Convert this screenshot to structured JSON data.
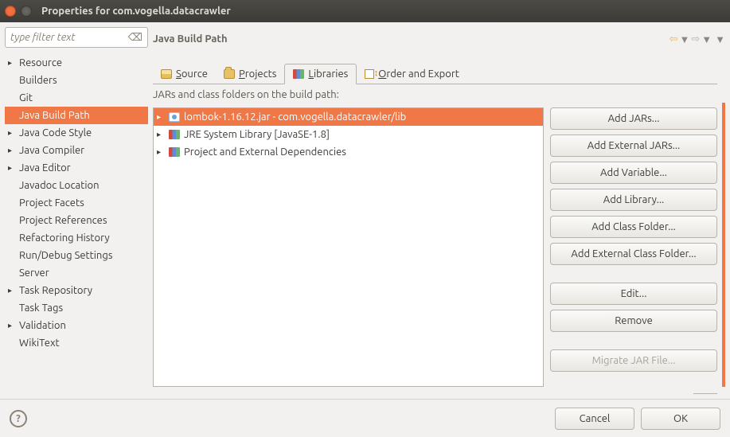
{
  "window": {
    "title": "Properties for com.vogella.datacrawler"
  },
  "filter": {
    "placeholder": "type filter text"
  },
  "navTree": [
    {
      "label": "Resource",
      "expandable": true
    },
    {
      "label": "Builders",
      "expandable": false
    },
    {
      "label": "Git",
      "expandable": false
    },
    {
      "label": "Java Build Path",
      "expandable": false,
      "selected": true
    },
    {
      "label": "Java Code Style",
      "expandable": true
    },
    {
      "label": "Java Compiler",
      "expandable": true
    },
    {
      "label": "Java Editor",
      "expandable": true
    },
    {
      "label": "Javadoc Location",
      "expandable": false
    },
    {
      "label": "Project Facets",
      "expandable": false
    },
    {
      "label": "Project References",
      "expandable": false
    },
    {
      "label": "Refactoring History",
      "expandable": false
    },
    {
      "label": "Run/Debug Settings",
      "expandable": false
    },
    {
      "label": "Server",
      "expandable": false
    },
    {
      "label": "Task Repository",
      "expandable": true
    },
    {
      "label": "Task Tags",
      "expandable": false
    },
    {
      "label": "Validation",
      "expandable": true
    },
    {
      "label": "WikiText",
      "expandable": false
    }
  ],
  "page": {
    "title": "Java Build Path",
    "tabs": {
      "source": "Source",
      "projects": "Projects",
      "libraries": "Libraries",
      "order": "Order and Export"
    },
    "desc": "JARs and class folders on the build path:",
    "libs": [
      {
        "label": "lombok-1.16.12.jar - com.vogella.datacrawler/lib",
        "icon": "jar",
        "selected": true
      },
      {
        "label": "JRE System Library [JavaSE-1.8]",
        "icon": "lib"
      },
      {
        "label": "Project and External Dependencies",
        "icon": "lib"
      }
    ],
    "buttons": {
      "addJars": "Add JARs...",
      "addExtJars": "Add External JARs...",
      "addVar": "Add Variable...",
      "addLib": "Add Library...",
      "addClassFolder": "Add Class Folder...",
      "addExtClassFolder": "Add External Class Folder...",
      "edit": "Edit...",
      "remove": "Remove",
      "migrate": "Migrate JAR File..."
    }
  },
  "dialog": {
    "cancel": "Cancel",
    "ok": "OK"
  }
}
